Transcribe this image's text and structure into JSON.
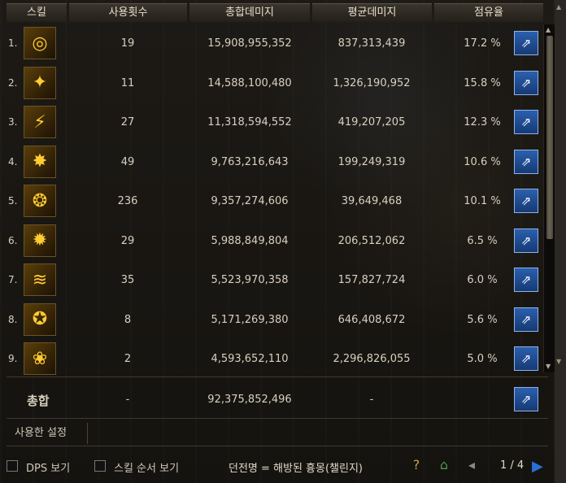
{
  "header": {
    "skill": "스킬",
    "count": "사용횟수",
    "total": "총합데미지",
    "avg": "평균데미지",
    "share": "점유율"
  },
  "rows": [
    {
      "idx": "1.",
      "count": "19",
      "total": "15,908,955,352",
      "avg": "837,313,439",
      "pct": "17.2 %"
    },
    {
      "idx": "2.",
      "count": "11",
      "total": "14,588,100,480",
      "avg": "1,326,190,952",
      "pct": "15.8 %"
    },
    {
      "idx": "3.",
      "count": "27",
      "total": "11,318,594,552",
      "avg": "419,207,205",
      "pct": "12.3 %"
    },
    {
      "idx": "4.",
      "count": "49",
      "total": "9,763,216,643",
      "avg": "199,249,319",
      "pct": "10.6 %"
    },
    {
      "idx": "5.",
      "count": "236",
      "total": "9,357,274,606",
      "avg": "39,649,468",
      "pct": "10.1 %"
    },
    {
      "idx": "6.",
      "count": "29",
      "total": "5,988,849,804",
      "avg": "206,512,062",
      "pct": "6.5 %"
    },
    {
      "idx": "7.",
      "count": "35",
      "total": "5,523,970,358",
      "avg": "157,827,724",
      "pct": "6.0 %"
    },
    {
      "idx": "8.",
      "count": "8",
      "total": "5,171,269,380",
      "avg": "646,408,672",
      "pct": "5.6 %"
    },
    {
      "idx": "9.",
      "count": "2",
      "total": "4,593,652,110",
      "avg": "2,296,826,055",
      "pct": "5.0 %"
    }
  ],
  "icons": [
    "skill-1-icon",
    "skill-2-icon",
    "skill-3-icon",
    "skill-4-icon",
    "skill-5-icon",
    "skill-6-icon",
    "skill-7-icon",
    "skill-8-icon",
    "skill-9-icon"
  ],
  "total_row": {
    "label": "총합",
    "count": "-",
    "total": "92,375,852,496",
    "avg": "-"
  },
  "settings_label": "사용한 설정",
  "bottom": {
    "dps_label": "DPS 보기",
    "order_label": "스킬 순서 보기",
    "dungeon_label": "던전명 = 해방된 흉몽(챌린지)",
    "page": "1 / 4"
  },
  "colors": {
    "accent": "#2b5fae",
    "text": "#d8cfbf",
    "icon_gold": "#ffcc33"
  }
}
